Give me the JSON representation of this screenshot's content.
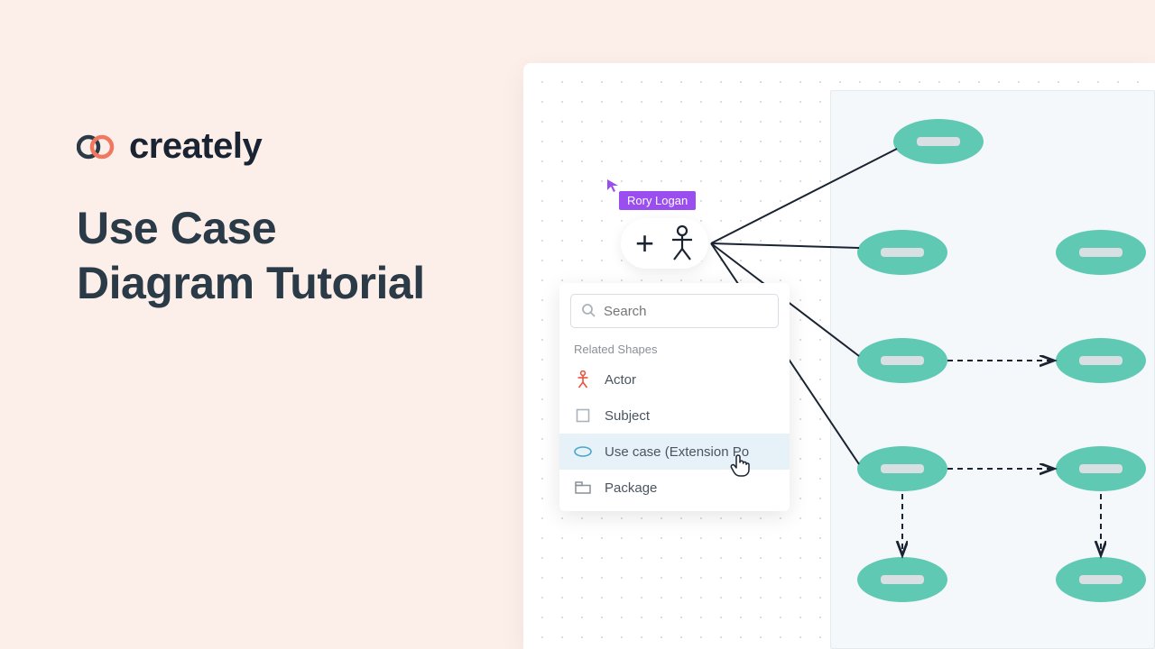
{
  "brand": {
    "name": "creately"
  },
  "title_line1": "Use Case",
  "title_line2": "Diagram Tutorial",
  "cursor_user": "Rory Logan",
  "search": {
    "placeholder": "Search"
  },
  "panel": {
    "section_label": "Related Shapes",
    "items": [
      {
        "label": "Actor",
        "icon": "actor"
      },
      {
        "label": "Subject",
        "icon": "subject"
      },
      {
        "label": "Use case (Extension Po",
        "icon": "usecase",
        "selected": true
      },
      {
        "label": "Package",
        "icon": "package"
      }
    ]
  }
}
